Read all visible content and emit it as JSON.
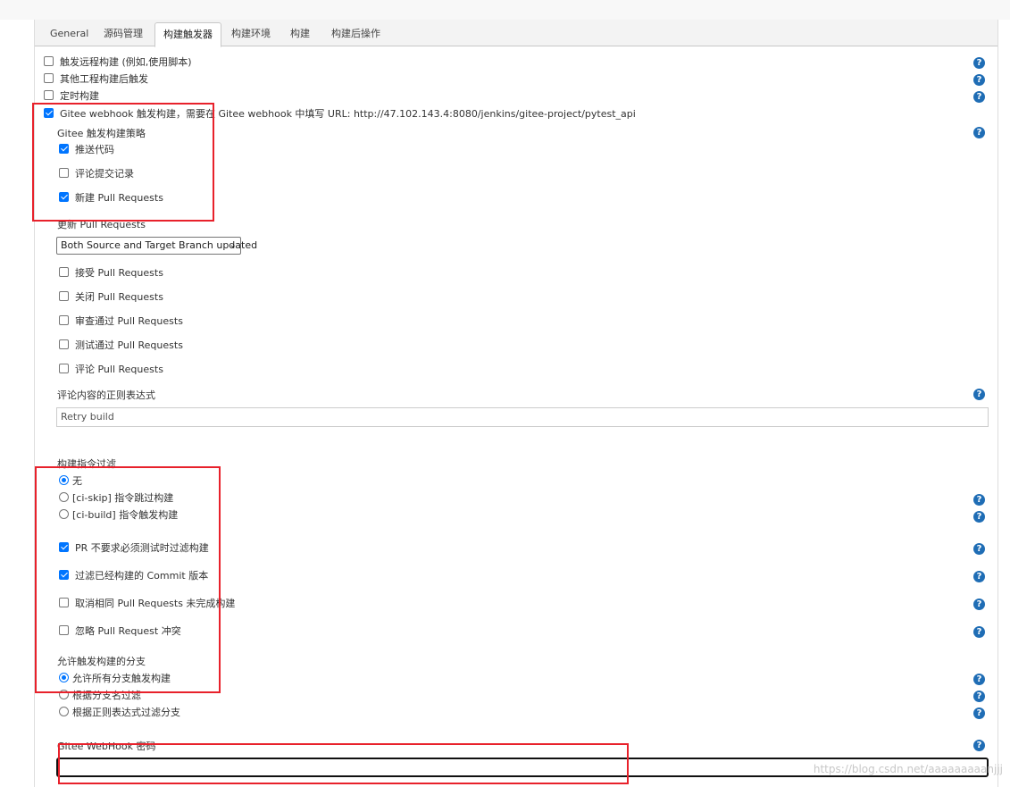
{
  "tabs": [
    {
      "label": "General",
      "active": false
    },
    {
      "label": "源码管理",
      "active": false
    },
    {
      "label": "构建触发器",
      "active": true
    },
    {
      "label": "构建环境",
      "active": false
    },
    {
      "label": "构建",
      "active": false
    },
    {
      "label": "构建后操作",
      "active": false
    }
  ],
  "triggers": {
    "remote": "触发远程构建 (例如,使用脚本)",
    "after_other": "其他工程构建后触发",
    "timer": "定时构建",
    "gitee": "Gitee webhook 触发构建，需要在 Gitee webhook 中填写 URL: http://47.102.143.4:8080/jenkins/gitee-project/pytest_api"
  },
  "strategy": {
    "title": "Gitee 触发构建策略",
    "push": "推送代码",
    "comment_commit": "评论提交记录",
    "new_pr": "新建 Pull Requests",
    "update_pr_label": "更新 Pull Requests",
    "update_pr_select": "Both Source and Target Branch updated",
    "accept_pr": "接受 Pull Requests",
    "close_pr": "关闭 Pull Requests",
    "review_pr": "审查通过 Pull Requests",
    "test_pr": "测试通过 Pull Requests",
    "comment_pr": "评论 Pull Requests"
  },
  "comment_regex": {
    "label": "评论内容的正则表达式",
    "value": "Retry build"
  },
  "ci_filter": {
    "title": "构建指令过滤",
    "none": "无",
    "skip": "[ci-skip] 指令跳过构建",
    "build": "[ci-build] 指令触发构建"
  },
  "options": {
    "pr_no_test": "PR 不要求必须测试时过滤构建",
    "filter_commit": "过滤已经构建的 Commit 版本",
    "cancel_same": "取消相同 Pull Requests 未完成构建",
    "ignore_conflict": "忽略 Pull Request 冲突"
  },
  "branches": {
    "title": "允许触发构建的分支",
    "all": "允许所有分支触发构建",
    "by_name": "根据分支名过滤",
    "by_regex": "根据正则表达式过滤分支"
  },
  "secret": {
    "label": "Gitee WebHook 密码",
    "value": ""
  },
  "help_glyph": "?",
  "select_chevron": "⌄",
  "watermark": "https://blog.csdn.net/aaaaaaaaanjjj",
  "colors": {
    "accent": "#0075ff",
    "help": "#1f6db5",
    "annotation": "#e8212b"
  }
}
